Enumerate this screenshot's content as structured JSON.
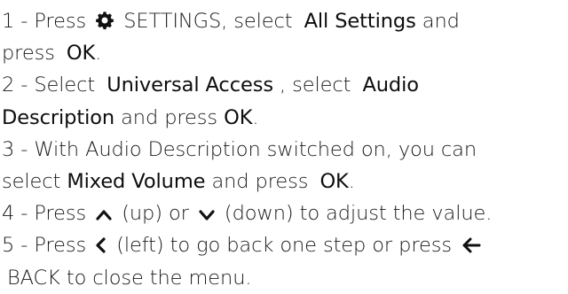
{
  "steps": [
    {
      "num": "1 - ",
      "parts": {
        "press": "Press",
        "settings_icon": "gear-icon",
        "settings": "SETTINGS, select",
        "all_settings": "All Settings",
        "and": "and",
        "press2": "press",
        "ok": "OK",
        "end": "."
      }
    },
    {
      "num": "2 - ",
      "parts": {
        "select": "Select",
        "universal_access": "Universal Access",
        "select2": ", select",
        "audio": "Audio",
        "description": "Description",
        "and_press": "and press",
        "ok": "OK",
        "end": "."
      }
    },
    {
      "num": "3 - ",
      "parts": {
        "with": "With Audio Description switched on, you can",
        "select": "select",
        "mixed_volume": "Mixed Volume",
        "and_press": "and press",
        "ok": "OK",
        "end": "."
      }
    },
    {
      "num": "4 - ",
      "parts": {
        "press": "Press",
        "up_icon": "chevron-up-icon",
        "up": "(up) or",
        "down_icon": "chevron-down-icon",
        "down": "(down) to adjust the value."
      }
    },
    {
      "num": "5 - ",
      "parts": {
        "press": "Press",
        "left_icon": "chevron-left-icon",
        "left": "(left) to go back one step or press",
        "back_icon": "arrow-left-icon",
        "back": "BACK to close the menu."
      }
    }
  ]
}
